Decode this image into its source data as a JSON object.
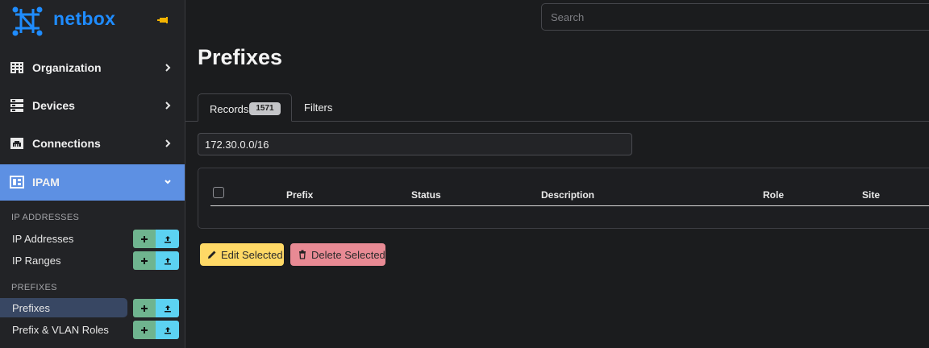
{
  "brand": {
    "name": "netbox"
  },
  "search": {
    "placeholder": "Search"
  },
  "sidebar": {
    "nav": [
      {
        "label": "Organization",
        "icon": "building-icon"
      },
      {
        "label": "Devices",
        "icon": "server-icon"
      },
      {
        "label": "Connections",
        "icon": "ethernet-icon"
      },
      {
        "label": "IPAM",
        "icon": "ipam-icon",
        "active": true
      }
    ],
    "sections": [
      {
        "title": "IP ADDRESSES",
        "items": [
          {
            "label": "IP Addresses"
          },
          {
            "label": "IP Ranges"
          }
        ]
      },
      {
        "title": "PREFIXES",
        "items": [
          {
            "label": "Prefixes",
            "active": true
          },
          {
            "label": "Prefix & VLAN Roles"
          }
        ]
      }
    ]
  },
  "page": {
    "title": "Prefixes",
    "tabs": {
      "records_label": "Records",
      "records_count": "1571",
      "filters_label": "Filters"
    },
    "filter_value": "172.30.0.0/16",
    "table": {
      "columns": [
        "Prefix",
        "Status",
        "Description",
        "Role",
        "Site"
      ]
    },
    "actions": {
      "edit_label": "Edit Selected",
      "delete_label": "Delete Selected"
    }
  },
  "colors": {
    "accent": "#5d90e3",
    "brand": "#1f8cff",
    "add": "#6fb48f",
    "import": "#5cd2f2",
    "edit": "#ffd966",
    "delete": "#e88a94"
  }
}
